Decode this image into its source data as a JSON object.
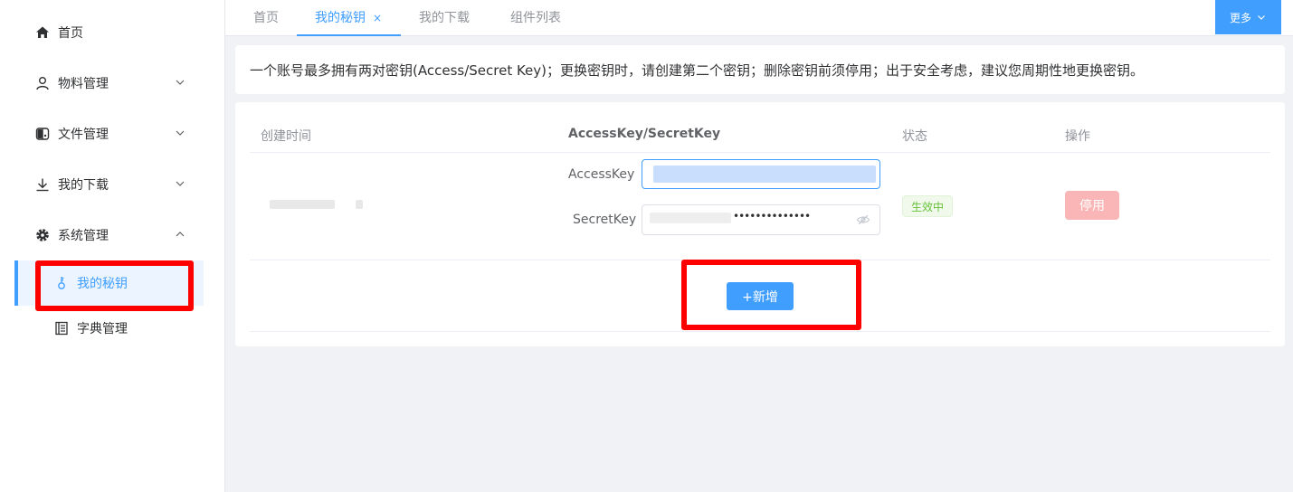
{
  "sidebar": {
    "items": [
      {
        "label": "首页",
        "icon": "home-icon"
      },
      {
        "label": "物料管理",
        "icon": "user-icon"
      },
      {
        "label": "文件管理",
        "icon": "folder-switch-icon"
      },
      {
        "label": "我的下载",
        "icon": "download-icon"
      },
      {
        "label": "系统管理",
        "icon": "gear-icon"
      }
    ],
    "sub_items": [
      {
        "label": "我的秘钥",
        "icon": "key-icon"
      },
      {
        "label": "字典管理",
        "icon": "book-icon"
      }
    ]
  },
  "tabs": {
    "items": [
      {
        "label": "首页"
      },
      {
        "label": "我的秘钥",
        "close": "×"
      },
      {
        "label": "我的下载"
      },
      {
        "label": "组件列表"
      }
    ],
    "more_label": "更多"
  },
  "notice": {
    "text": "一个账号最多拥有两对密钥(Access/Secret Key)；更换密钥时，请创建第二个密钥；删除密钥前须停用；出于安全考虑，建议您周期性地更换密钥。"
  },
  "table": {
    "headers": [
      "创建时间",
      "AccessKey/SecretKey",
      "状态",
      "操作"
    ],
    "row": {
      "access_label": "AccessKey",
      "secret_label": "SecretKey",
      "secret_mask": "••••••••••••••",
      "status": "生效中",
      "action": "停用"
    },
    "add_label": "+新增"
  },
  "colors": {
    "accent": "#409eff",
    "highlight": "#ff0000",
    "status_green": "#67c23a",
    "danger_light": "#fab6b6"
  }
}
